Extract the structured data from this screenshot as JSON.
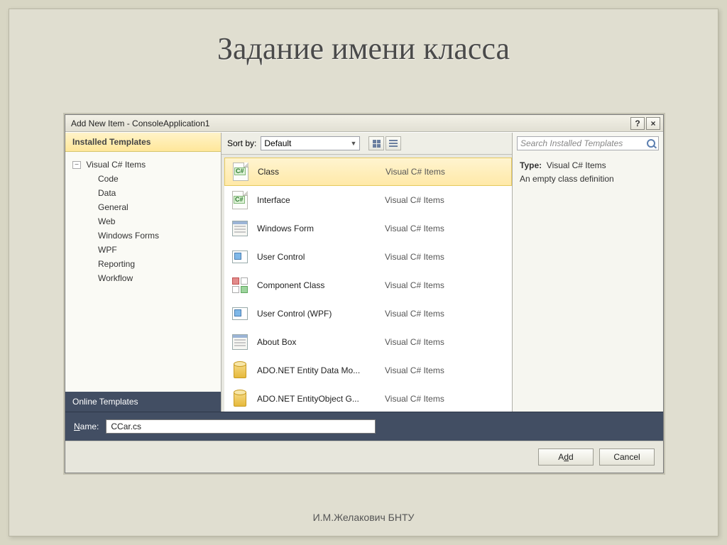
{
  "slide": {
    "title": "Задание имени класса",
    "credit": "И.М.Желакович БНТУ"
  },
  "dialog": {
    "title": "Add New Item - ConsoleApplication1",
    "help_symbol": "?",
    "close_symbol": "×",
    "sidebar": {
      "header": "Installed Templates",
      "root": "Visual C# Items",
      "children": [
        "Code",
        "Data",
        "General",
        "Web",
        "Windows Forms",
        "WPF",
        "Reporting",
        "Workflow"
      ],
      "footer": "Online Templates"
    },
    "toolbar": {
      "sort_label": "Sort by:",
      "sort_value": "Default"
    },
    "search_placeholder": "Search Installed Templates",
    "items": [
      {
        "name": "Class",
        "cat": "Visual C# Items",
        "icon": "cs",
        "sel": true
      },
      {
        "name": "Interface",
        "cat": "Visual C# Items",
        "icon": "cs"
      },
      {
        "name": "Windows Form",
        "cat": "Visual C# Items",
        "icon": "form"
      },
      {
        "name": "User Control",
        "cat": "Visual C# Items",
        "icon": "ctrl"
      },
      {
        "name": "Component Class",
        "cat": "Visual C# Items",
        "icon": "comp"
      },
      {
        "name": "User Control (WPF)",
        "cat": "Visual C# Items",
        "icon": "ctrl"
      },
      {
        "name": "About Box",
        "cat": "Visual C# Items",
        "icon": "form"
      },
      {
        "name": "ADO.NET Entity Data Mo...",
        "cat": "Visual C# Items",
        "icon": "db"
      },
      {
        "name": "ADO.NET EntityObject G...",
        "cat": "Visual C# Items",
        "icon": "db"
      }
    ],
    "details": {
      "type_label": "Type:",
      "type_value": "Visual C# Items",
      "desc": "An empty class definition"
    },
    "name_label_pre": "N",
    "name_label_post": "ame:",
    "name_value": "CCar.cs",
    "buttons": {
      "add_pre": "A",
      "add_ul": "d",
      "add_post": "d",
      "cancel": "Cancel"
    }
  }
}
